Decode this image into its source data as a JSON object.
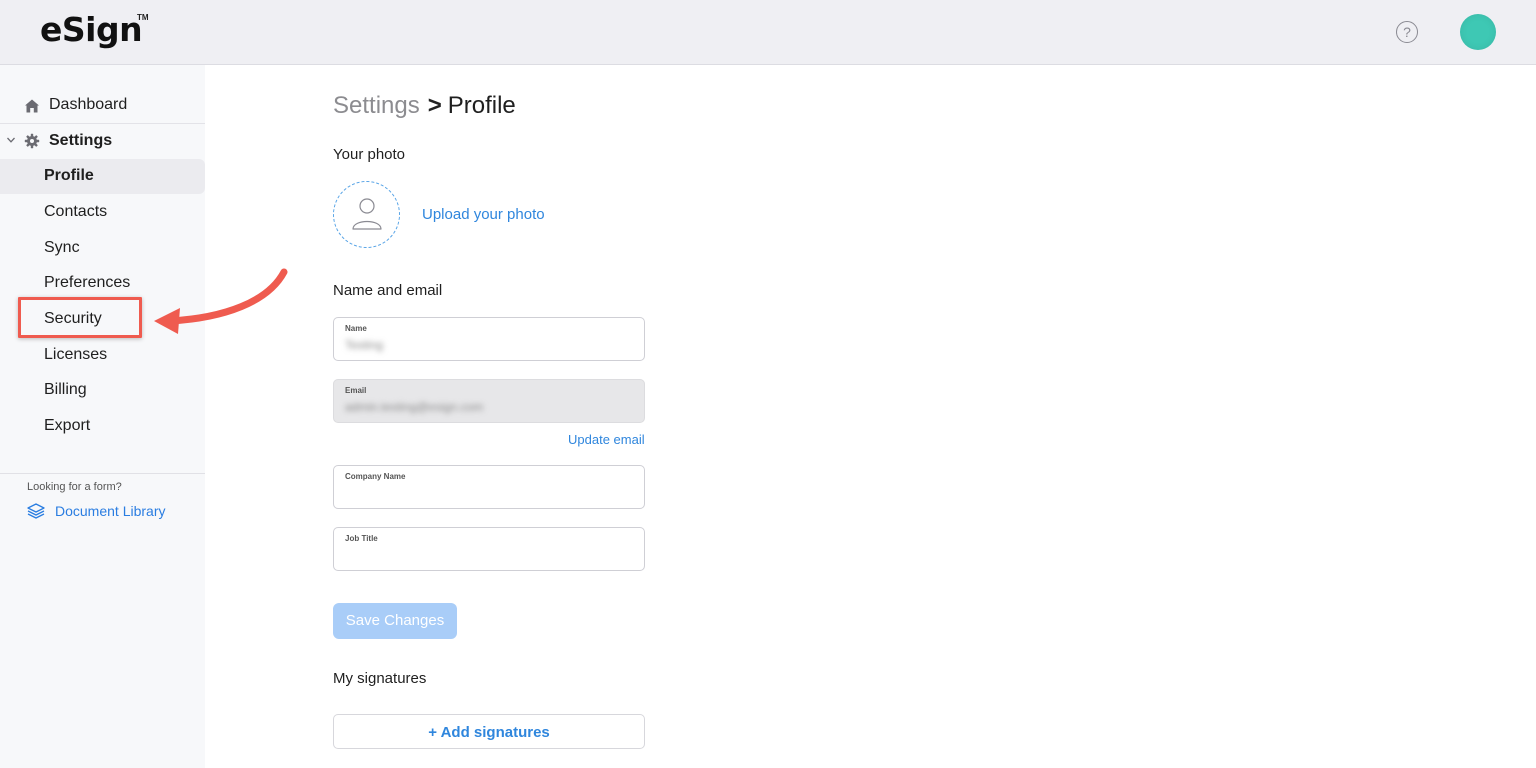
{
  "header": {
    "logo": "eSign",
    "logo_tm": "TM",
    "help_glyph": "?",
    "colors": {
      "bar": "#efeff3",
      "avatar": "#3ec8b4"
    }
  },
  "sidebar": {
    "dashboard_label": "Dashboard",
    "settings_label": "Settings",
    "items": [
      {
        "label": "Profile",
        "active": true
      },
      {
        "label": "Contacts"
      },
      {
        "label": "Sync"
      },
      {
        "label": "Preferences"
      },
      {
        "label": "Security",
        "highlighted": true
      },
      {
        "label": "Licenses"
      },
      {
        "label": "Billing"
      },
      {
        "label": "Export"
      }
    ],
    "looking_text": "Looking for a form?",
    "document_library_label": "Document Library"
  },
  "main": {
    "breadcrumb": {
      "parent": "Settings",
      "separator": ">",
      "current": "Profile"
    },
    "photo_section_label": "Your photo",
    "upload_link": "Upload your photo",
    "name_email_section_label": "Name and email",
    "fields": {
      "name_label": "Name",
      "name_value": "Testing",
      "email_label": "Email",
      "email_value": "admin.testing@esign.com",
      "company_label": "Company Name",
      "job_label": "Job Title"
    },
    "update_email_link": "Update email",
    "save_button": "Save Changes",
    "signatures_section_label": "My signatures",
    "add_signatures_button": "+ Add signatures"
  },
  "accent_color": "#2f86dd",
  "annotation_color": "#ef5b4f"
}
